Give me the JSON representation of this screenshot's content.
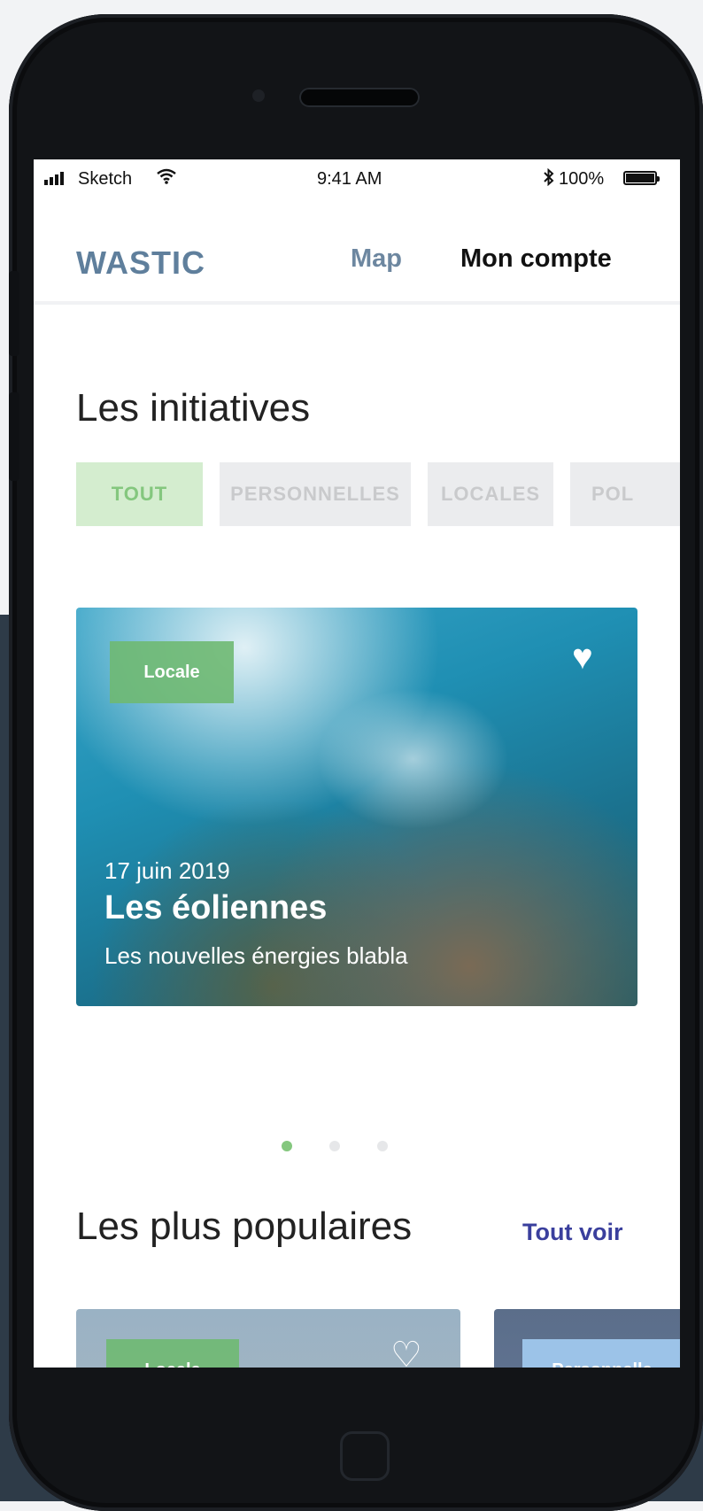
{
  "status_bar": {
    "carrier": "Sketch",
    "time": "9:41 AM",
    "battery": "100%",
    "icons": [
      "signal-icon",
      "wifi-icon",
      "bluetooth-icon",
      "battery-icon"
    ]
  },
  "header": {
    "logo": "WASTIC",
    "nav": {
      "map": "Map",
      "account": "Mon compte"
    }
  },
  "initiatives": {
    "title": "Les initiatives",
    "filters": [
      {
        "label": "TOUT",
        "active": true
      },
      {
        "label": "PERSONNELLES",
        "active": false
      },
      {
        "label": "LOCALES",
        "active": false
      },
      {
        "label": "POL",
        "active": false
      }
    ]
  },
  "featured": {
    "badge": "Locale",
    "date": "17 juin 2019",
    "title": "Les éoliennes",
    "subtitle": "Les nouvelles énergies blabla",
    "favorite": true,
    "carousel": {
      "total": 3,
      "active_index": 0
    }
  },
  "popular": {
    "title": "Les plus populaires",
    "see_all": "Tout voir",
    "cards": [
      {
        "badge": "Locale",
        "favorite": false
      },
      {
        "badge": "Personnelle"
      }
    ]
  },
  "colors": {
    "accent_green": "#84c77e",
    "logo_blue": "#5f7f9c",
    "link_indigo": "#3a3f9d",
    "badge_blue": "#9cc3e8"
  }
}
